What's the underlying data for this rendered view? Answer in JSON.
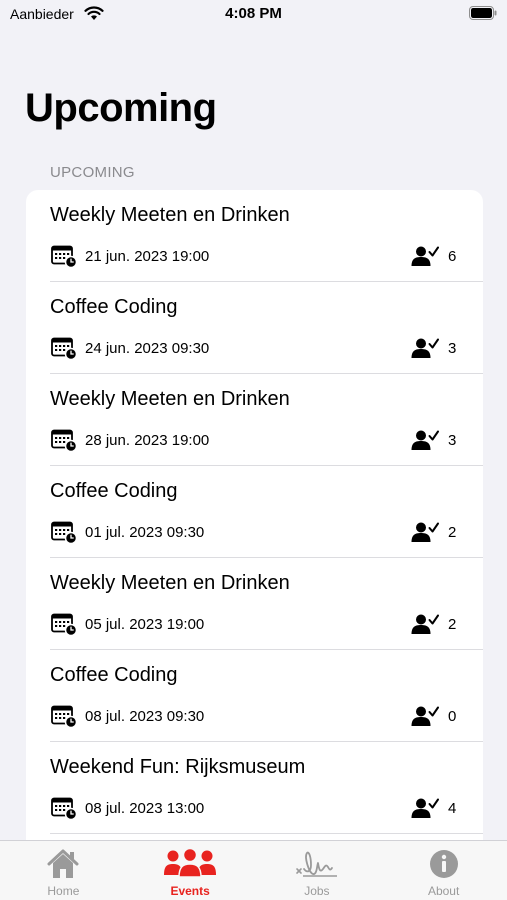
{
  "status_bar": {
    "carrier": "Aanbieder",
    "time": "4:08 PM"
  },
  "page_title": "Upcoming",
  "section_header": "UPCOMING",
  "events": [
    {
      "title": "Weekly Meeten en Drinken",
      "datetime": "21 jun. 2023 19:00",
      "attendees": "6"
    },
    {
      "title": "Coffee Coding",
      "datetime": "24 jun. 2023 09:30",
      "attendees": "3"
    },
    {
      "title": "Weekly Meeten en Drinken",
      "datetime": "28 jun. 2023 19:00",
      "attendees": "3"
    },
    {
      "title": "Coffee Coding",
      "datetime": "01 jul. 2023 09:30",
      "attendees": "2"
    },
    {
      "title": "Weekly Meeten en Drinken",
      "datetime": "05 jul. 2023 19:00",
      "attendees": "2"
    },
    {
      "title": "Coffee Coding",
      "datetime": "08 jul. 2023 09:30",
      "attendees": "0"
    },
    {
      "title": "Weekend Fun: Rijksmuseum",
      "datetime": "08 jul. 2023 13:00",
      "attendees": "4"
    }
  ],
  "tab_bar": {
    "tabs": [
      {
        "label": "Home",
        "icon": "house-icon",
        "active": false
      },
      {
        "label": "Events",
        "icon": "group-icon",
        "active": true
      },
      {
        "label": "Jobs",
        "icon": "signature-icon",
        "active": false
      },
      {
        "label": "About",
        "icon": "info-icon",
        "active": false
      }
    ]
  },
  "colors": {
    "accent": "#e8231f",
    "inactive": "#9a9a9a",
    "background": "#f2f2f7",
    "card": "#ffffff"
  }
}
